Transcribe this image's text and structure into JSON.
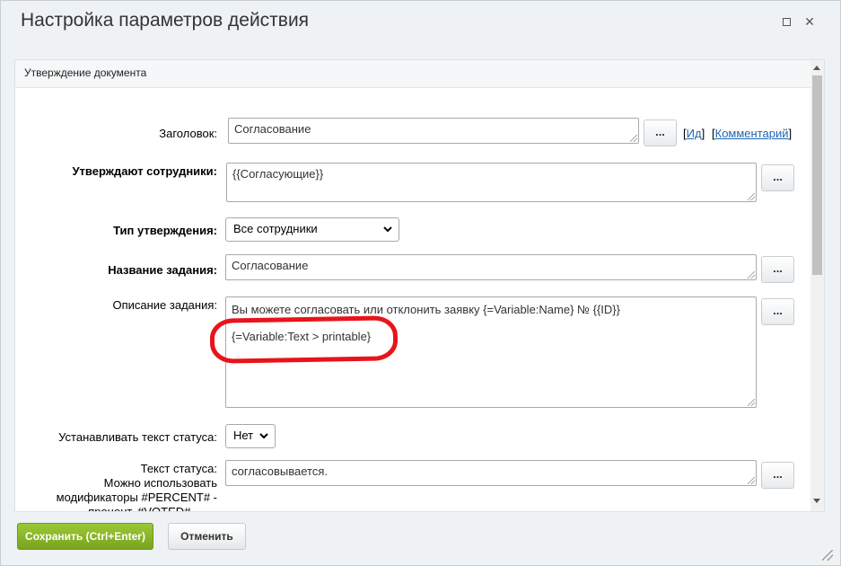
{
  "dialog": {
    "title": "Настройка параметров действия",
    "maximize_icon": "maximize-icon",
    "close_icon": "close-icon",
    "close_glyph": "✕"
  },
  "section": {
    "title": "Утверждение документа"
  },
  "form": {
    "heading": {
      "label": "Заголовок:",
      "value": "Согласование",
      "dots": "...",
      "id_link": "Ид",
      "comment_link": "Комментарий",
      "bracket_open": "[",
      "bracket_close": "]"
    },
    "approvers": {
      "label": "Утверждают сотрудники:",
      "value": "{{Согласующие}}",
      "dots": "..."
    },
    "approval_type": {
      "label": "Тип утверждения:",
      "selected": "Все сотрудники"
    },
    "task_name": {
      "label": "Название задания:",
      "value": "Согласование",
      "dots": "..."
    },
    "task_description": {
      "label": "Описание задания:",
      "line1": "Вы можете согласовать или отклонить заявку {=Variable:Name} № {{ID}}",
      "line2": "{=Variable:Text > printable}",
      "dots": "..."
    },
    "set_status": {
      "label": "Устанавливать текст статуса:",
      "selected": "Нет"
    },
    "status_text": {
      "label_line1": "Текст статуса:",
      "label_line2": "Можно использовать",
      "label_line3": "модификаторы #PERCENT# -",
      "label_line4": "процент, #VOTED# - , ...",
      "value": "согласовывается.",
      "dots": "..."
    }
  },
  "footer": {
    "save_label": "Сохранить (Ctrl+Enter)",
    "cancel_label": "Отменить"
  },
  "colors": {
    "save_button": "#8db52a",
    "link": "#2067b0",
    "annotation": "#e8141a"
  }
}
